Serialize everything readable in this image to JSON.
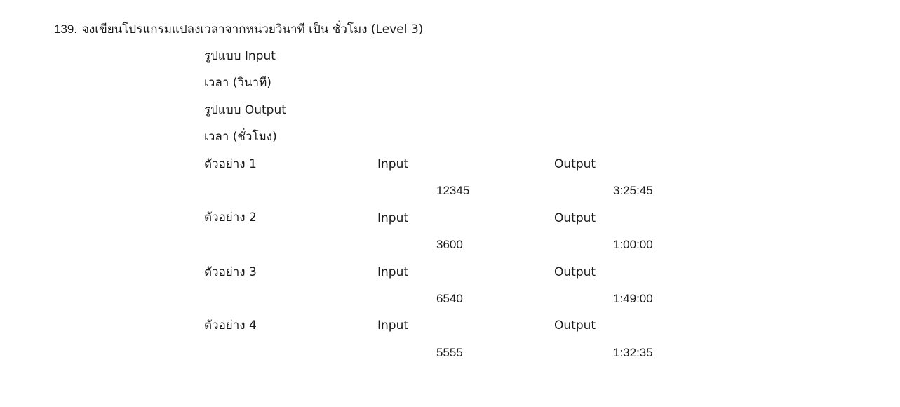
{
  "problem": {
    "number": "139.",
    "title": "จงเขียนโปรแกรมแปลงเวลาจากหน่วยวินาที เป็น ชั่วโมง (Level 3)"
  },
  "format": {
    "input_heading": "รูปแบบ Input",
    "input_desc": "เวลา (วินาที)",
    "output_heading": "รูปแบบ Output",
    "output_desc": "เวลา (ชั่วโมง)"
  },
  "examples": [
    {
      "label": "ตัวอย่าง 1",
      "input_label": "Input",
      "output_label": "Output",
      "input": "12345",
      "output": "3:25:45"
    },
    {
      "label": "ตัวอย่าง 2",
      "input_label": "Input",
      "output_label": "Output",
      "input": "3600",
      "output": "1:00:00"
    },
    {
      "label": "ตัวอย่าง 3",
      "input_label": "Input",
      "output_label": "Output",
      "input": "6540",
      "output": "1:49:00"
    },
    {
      "label": "ตัวอย่าง 4",
      "input_label": "Input",
      "output_label": "Output",
      "input": "5555",
      "output": "1:32:35"
    }
  ]
}
